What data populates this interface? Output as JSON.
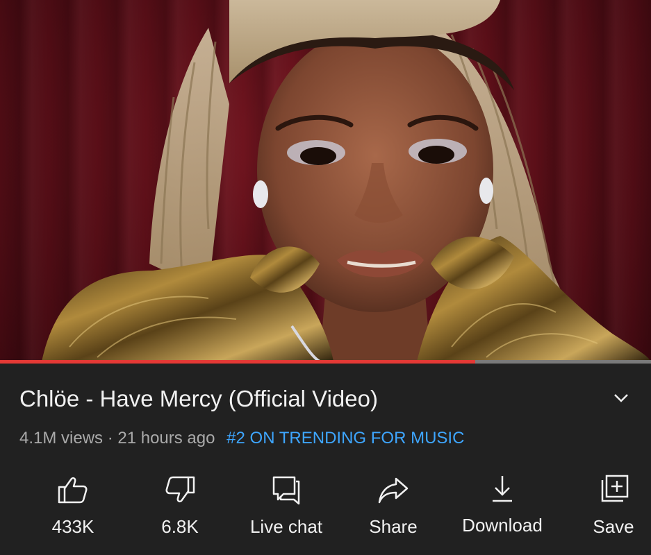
{
  "video": {
    "title": "Chlöe - Have Mercy (Official Video)",
    "views_line": "4.1M views · 21 hours ago",
    "trending": "#2 ON TRENDING FOR MUSIC",
    "progress_fraction": 0.73
  },
  "actions": {
    "like": {
      "label": "433K",
      "icon": "thumbs-up-icon"
    },
    "dislike": {
      "label": "6.8K",
      "icon": "thumbs-down-icon"
    },
    "live_chat": {
      "label": "Live chat",
      "icon": "chat-icon"
    },
    "share": {
      "label": "Share",
      "icon": "share-arrow-icon"
    },
    "download": {
      "label": "Download",
      "icon": "download-icon"
    },
    "save": {
      "label": "Save",
      "icon": "add-to-playlist-icon"
    }
  },
  "colors": {
    "background": "#212121",
    "text": "#f1f1f1",
    "secondary_text": "#aaaaaa",
    "trending": "#3ea6ff",
    "progress": "#e53935"
  }
}
